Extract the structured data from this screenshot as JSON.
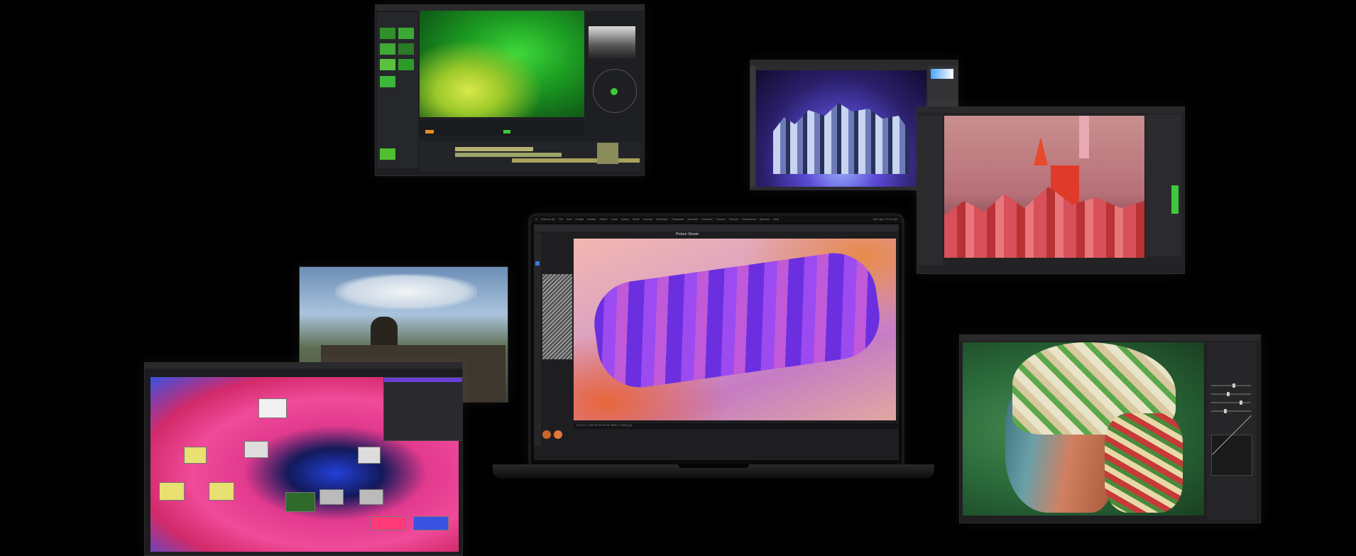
{
  "macbook": {
    "menu_items": [
      "Cinema 4D",
      "File",
      "Edit",
      "Create",
      "Modes",
      "Select",
      "Tools",
      "Spline",
      "Mesh",
      "Volume",
      "MoGraph",
      "Character",
      "Animate",
      "Simulate",
      "Tracker",
      "Render",
      "Extensions",
      "Window",
      "Help"
    ],
    "menu_clock": "Mon Apr 1  9:41 AM",
    "viewer_title": "Picture Viewer",
    "status_text": "0:00:27 / 0:00:00  00:00:00  4000 × 2200 (px)"
  },
  "apps": {
    "color_grading": {
      "name": "color-grading-app"
    },
    "photo_editor": {
      "name": "photo-editor-app"
    },
    "render_3d": {
      "name": "3d-render-app"
    },
    "node_editor": {
      "name": "node-editor-app"
    },
    "portrait_editor": {
      "name": "portrait-editor-app"
    }
  },
  "colors": {
    "background": "#000000",
    "accent_purple": "#6b3fd6",
    "pink": "#e23a8e",
    "green": "#39c43a"
  }
}
